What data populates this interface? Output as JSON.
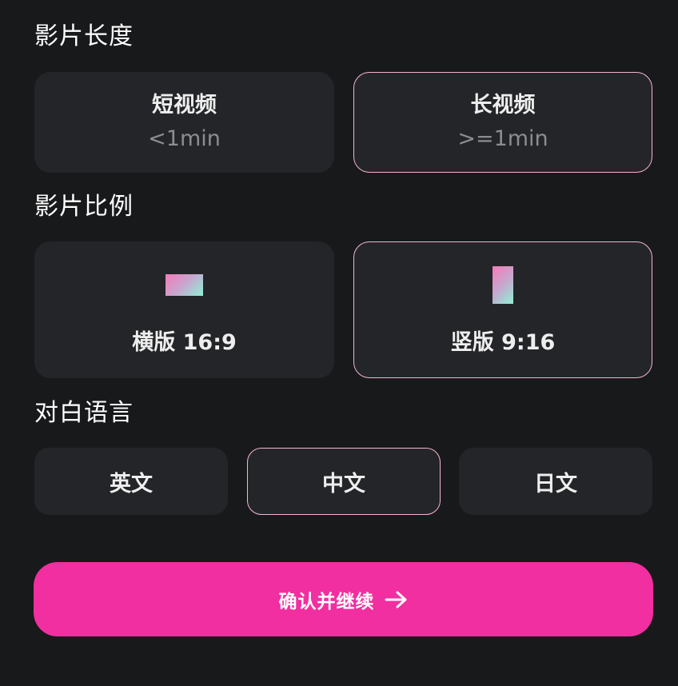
{
  "length_section": {
    "title": "影片长度",
    "options": [
      {
        "title": "短视频",
        "sub": "<1min",
        "selected": false
      },
      {
        "title": "长视频",
        "sub": ">=1min",
        "selected": true
      }
    ]
  },
  "ratio_section": {
    "title": "影片比例",
    "options": [
      {
        "label": "横版 16:9",
        "icon": "landscape-ratio-icon",
        "selected": false
      },
      {
        "label": "竖版 9:16",
        "icon": "portrait-ratio-icon",
        "selected": true
      }
    ]
  },
  "language_section": {
    "title": "对白语言",
    "options": [
      {
        "label": "英文",
        "selected": false
      },
      {
        "label": "中文",
        "selected": true
      },
      {
        "label": "日文",
        "selected": false
      }
    ]
  },
  "confirm": {
    "label": "确认并继续",
    "icon": "arrow-right-icon"
  },
  "colors": {
    "background": "#18191b",
    "card": "#242528",
    "selected_border": "#f4b6d4",
    "accent": "#f12fa0"
  }
}
